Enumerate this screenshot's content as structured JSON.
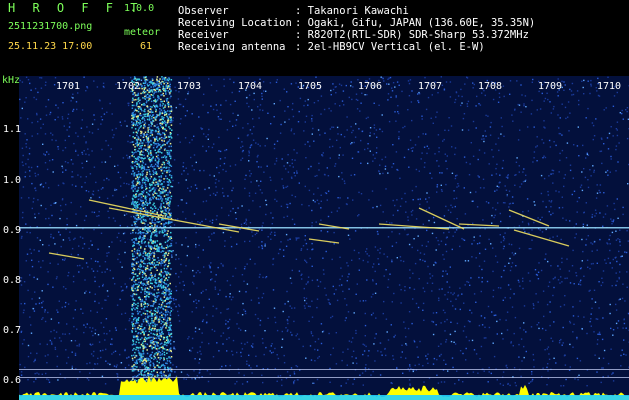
{
  "app": {
    "name": "H R O F F T",
    "version": "1.0.0"
  },
  "file": {
    "name": "2511231700.png",
    "datetime": "25.11.23 17:00"
  },
  "detection": {
    "label": "meteor",
    "count": "61"
  },
  "station": {
    "rows": [
      {
        "label": "Observer",
        "value": ": Takanori Kawachi"
      },
      {
        "label": "Receiving Location",
        "value": ": Ogaki, Gifu, JAPAN (136.60E, 35.35N)"
      },
      {
        "label": "Receiver",
        "value": ": R820T2(RTL-SDR) SDR-Sharp 53.372MHz"
      },
      {
        "label": "Receiving antenna",
        "value": ": 2el-HB9CV Vertical (el. E-W)"
      }
    ]
  },
  "axis": {
    "unit": "kHz",
    "x_ticks": [
      "1701",
      "1702",
      "1703",
      "1704",
      "1705",
      "1706",
      "1707",
      "1708",
      "1709",
      "1710"
    ],
    "y_ticks": [
      "1.1",
      "1.0",
      "0.9",
      "0.8",
      "0.7",
      "0.6"
    ]
  },
  "colors": {
    "background": "#000000",
    "plot_background": "#03103c",
    "noise": "#2a5bd6",
    "trail": "#f0e060",
    "baseline": "#ffff00",
    "carrier": "#9adfff",
    "header_green": "#7dff5a",
    "header_yellow": "#ffd84a"
  }
}
